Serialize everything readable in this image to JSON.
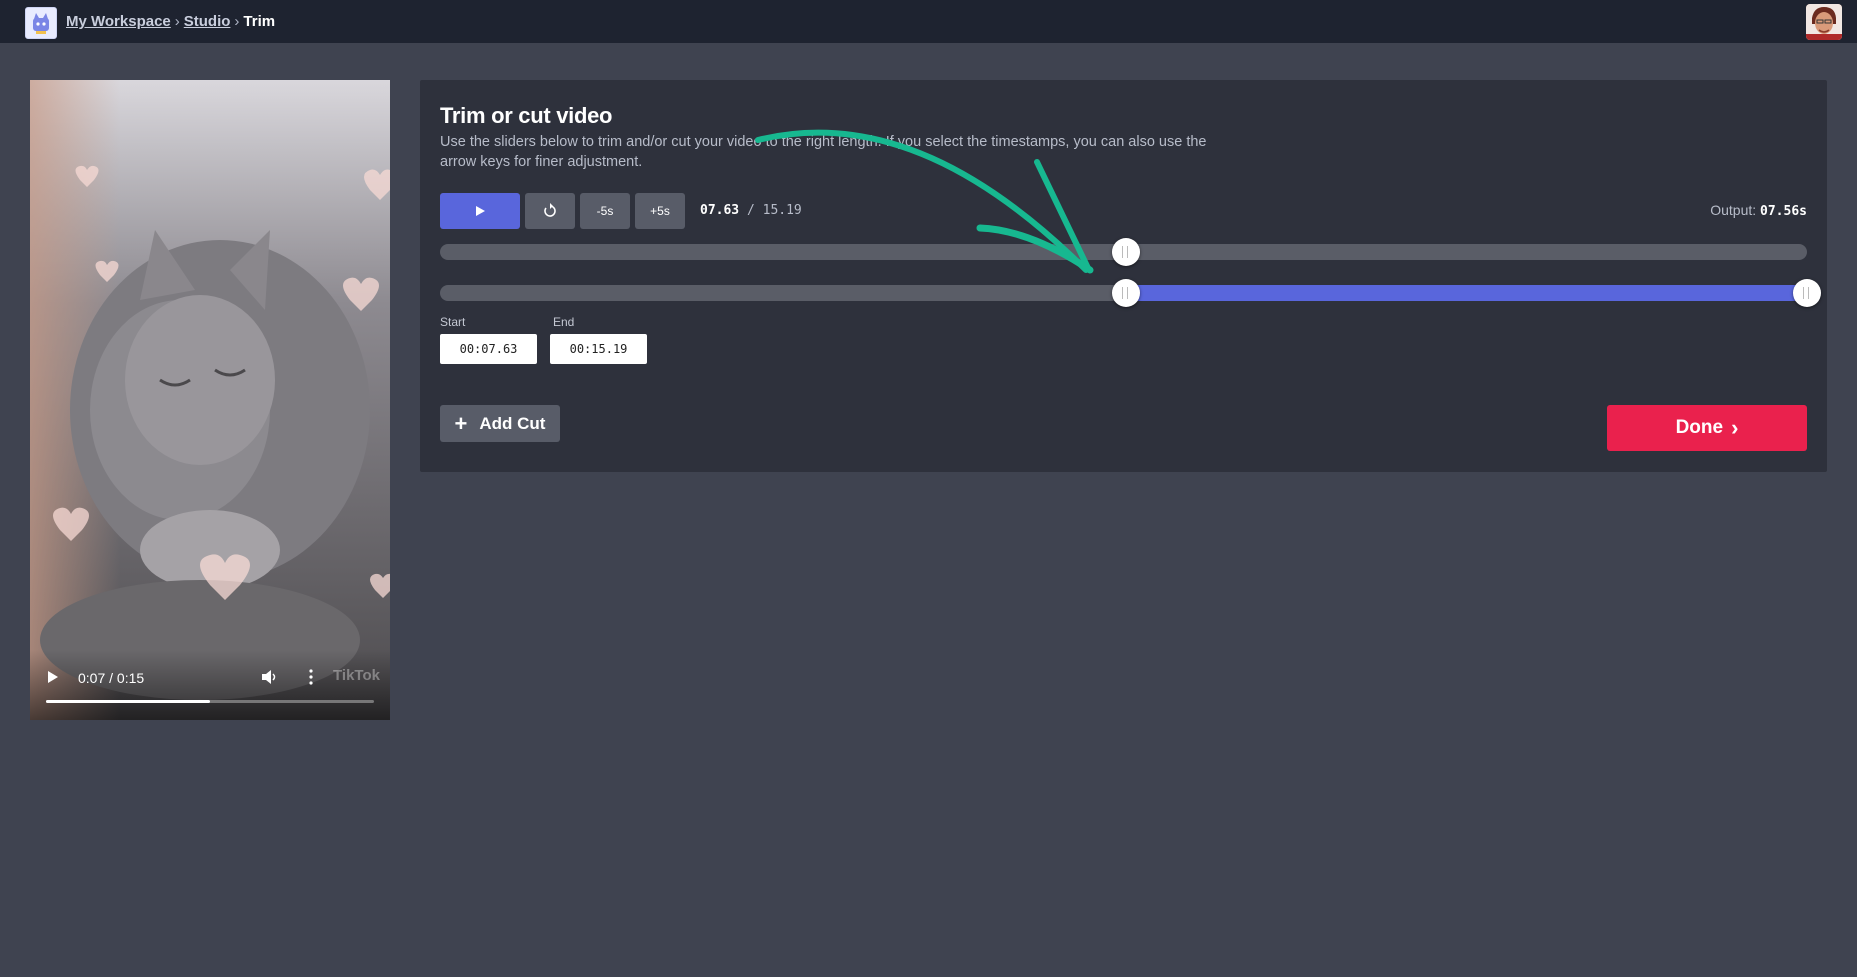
{
  "breadcrumb": {
    "workspace": "My Workspace",
    "studio": "Studio",
    "current": "Trim",
    "separator": "›"
  },
  "video": {
    "time": "0:07 / 0:15",
    "progress_fraction": 0.5,
    "watermark": "TikTok"
  },
  "trim": {
    "title": "Trim or cut video",
    "description": "Use the sliders below to trim and/or cut your video to the right length. If you select the timestamps, you can also use the arrow keys for finer adjustment.",
    "minus5_label": "-5s",
    "plus5_label": "+5s",
    "current_time": "07.63",
    "time_separator": " / ",
    "total_time": "15.19",
    "output_label": "Output: ",
    "output_value": "07.56s",
    "playhead_fraction": 0.502,
    "range_start_fraction": 0.502,
    "range_end_fraction": 1.0,
    "start_label": "Start",
    "start_value": "00:07.63",
    "end_label": "End",
    "end_value": "00:15.19",
    "add_cut_label": "Add Cut",
    "done_label": "Done"
  },
  "colors": {
    "accent": "#5966dc",
    "done": "#ea214d",
    "annotation": "#17b890"
  }
}
